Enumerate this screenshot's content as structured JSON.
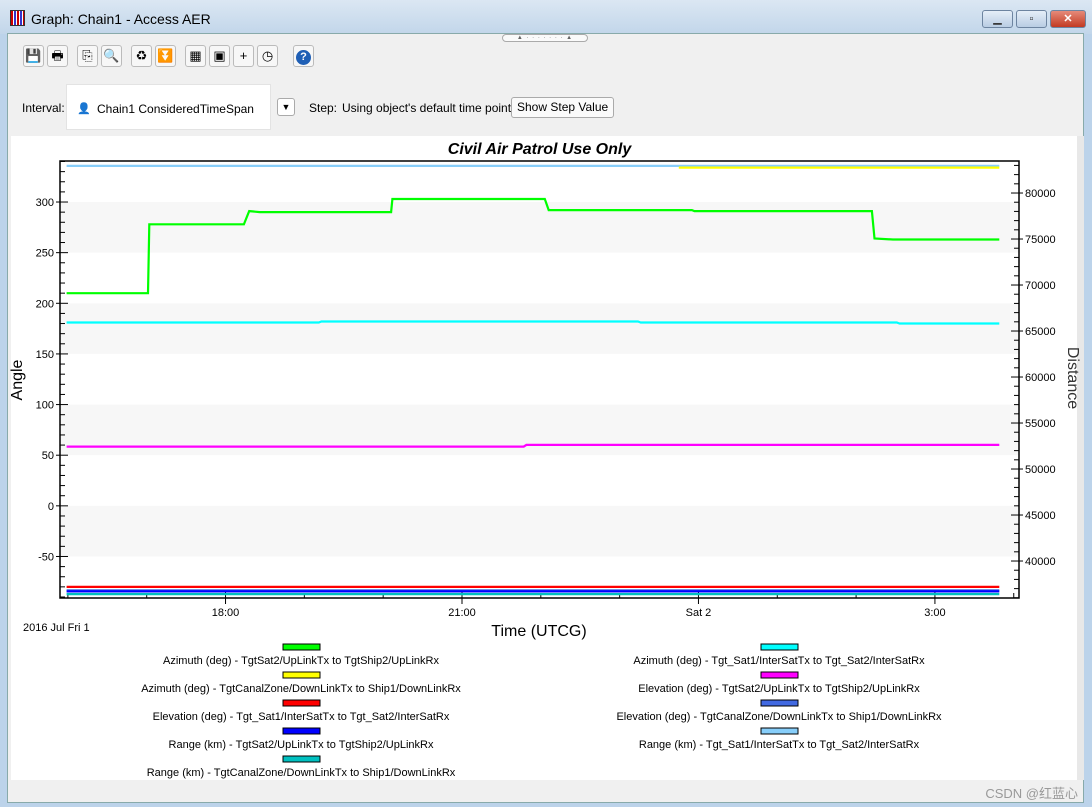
{
  "window": {
    "title": "Graph:  Chain1 - Access AER",
    "minimize": "▁",
    "maximize": "▫",
    "close": "✕"
  },
  "toolbar": [
    {
      "name": "save-icon",
      "glyph": "💾"
    },
    {
      "name": "print-icon",
      "glyph": "🖶"
    },
    {
      "name": "copy-icon",
      "glyph": "⎘"
    },
    {
      "name": "zoom-out-icon",
      "glyph": "🔍"
    },
    {
      "name": "refresh-icon",
      "glyph": "♻"
    },
    {
      "name": "export-icon",
      "glyph": "⏬"
    },
    {
      "name": "properties-icon",
      "glyph": "▦"
    },
    {
      "name": "save-as-icon",
      "glyph": "▣"
    },
    {
      "name": "crosshair-icon",
      "glyph": "+"
    },
    {
      "name": "time-icon",
      "glyph": "◷"
    },
    {
      "name": "help-icon",
      "glyph": "?"
    }
  ],
  "interval": {
    "label": "Interval:",
    "value": "Chain1 ConsideredTimeSpan",
    "dropdown": "▼"
  },
  "step": {
    "label": "Step:",
    "value": "Using object's default time points",
    "button": "Show Step Value"
  },
  "watermark": "CSDN @红蓝心",
  "chart_data": {
    "type": "line",
    "title": "Civil Air Patrol Use Only",
    "xlabel": "Time (UTCG)",
    "ylabel": "Angle",
    "y2label": "Distance",
    "date_label": "2016 Jul Fri 1",
    "xlim": [
      "2016-07-01 15:54",
      "2016-07-02 04:04"
    ],
    "ylim": [
      -91,
      340.5
    ],
    "y2lim": [
      35980,
      83480
    ],
    "xticks": [
      {
        "t": "2016-07-01 18:00",
        "label": "18:00"
      },
      {
        "t": "2016-07-01 21:00",
        "label": "21:00"
      },
      {
        "t": "2016-07-02 00:00",
        "label": "Sat 2"
      },
      {
        "t": "2016-07-02 03:00",
        "label": "3:00"
      }
    ],
    "yticks": [
      -50,
      0,
      50,
      100,
      150,
      200,
      250,
      300
    ],
    "y2ticks": [
      40000,
      45000,
      50000,
      55000,
      60000,
      65000,
      70000,
      75000,
      80000
    ],
    "grid": "alternating horizontal bands",
    "legend": "bottom",
    "series": [
      {
        "name": "Azimuth (deg) - TgtSat2/UpLinkTx to TgtShip2/UpLinkRx",
        "color": "#00ff00",
        "axis": "left",
        "points": [
          [
            "2016-07-01 15:59",
            210
          ],
          [
            "2016-07-01 17:01",
            210
          ],
          [
            "2016-07-01 17:02",
            278
          ],
          [
            "2016-07-01 18:14",
            278
          ],
          [
            "2016-07-01 18:18",
            291
          ],
          [
            "2016-07-01 18:26",
            290
          ],
          [
            "2016-07-01 20:06",
            290
          ],
          [
            "2016-07-01 20:07",
            303
          ],
          [
            "2016-07-01 22:03",
            303
          ],
          [
            "2016-07-01 22:06",
            292
          ],
          [
            "2016-07-01 23:55",
            292
          ],
          [
            "2016-07-01 23:57",
            291
          ],
          [
            "2016-07-02 02:12",
            291
          ],
          [
            "2016-07-02 02:14",
            264
          ],
          [
            "2016-07-02 02:28",
            263
          ],
          [
            "2016-07-02 03:49",
            263
          ]
        ]
      },
      {
        "name": "Azimuth (deg) - Tgt_Sat1/InterSatTx to Tgt_Sat2/InterSatRx",
        "color": "#00ffff",
        "axis": "left",
        "points": [
          [
            "2016-07-01 15:59",
            181
          ],
          [
            "2016-07-01 19:11",
            181
          ],
          [
            "2016-07-01 19:13",
            182
          ],
          [
            "2016-07-01 23:14",
            182
          ],
          [
            "2016-07-01 23:16",
            181
          ],
          [
            "2016-07-02 02:31",
            181
          ],
          [
            "2016-07-02 02:33",
            180
          ],
          [
            "2016-07-02 03:49",
            180
          ]
        ]
      },
      {
        "name": "Azimuth (deg) - TgtCanalZone/DownLinkTx to Ship1/DownLinkRx",
        "color": "#ffff00",
        "axis": "left",
        "points": [
          [
            "2016-07-01 23:45",
            334
          ],
          [
            "2016-07-02 03:49",
            334
          ]
        ]
      },
      {
        "name": "Elevation (deg) - TgtSat2/UpLinkTx to TgtShip2/UpLinkRx",
        "color": "#ff00ff",
        "axis": "left",
        "points": [
          [
            "2016-07-01 15:59",
            58.5
          ],
          [
            "2016-07-01 21:47",
            58.5
          ],
          [
            "2016-07-01 21:49",
            60.2
          ],
          [
            "2016-07-02 03:49",
            60.2
          ]
        ]
      },
      {
        "name": "Elevation (deg) - Tgt_Sat1/InterSatTx to Tgt_Sat2/InterSatRx",
        "color": "#ff0000",
        "axis": "left",
        "points": [
          [
            "2016-07-01 15:59",
            -80
          ],
          [
            "2016-07-02 03:49",
            -80
          ]
        ]
      },
      {
        "name": "Elevation (deg) - TgtCanalZone/DownLinkTx to Ship1/DownLinkRx",
        "color": "#4169e1",
        "axis": "left",
        "points": [
          [
            "2016-07-01 15:59",
            -83.5
          ],
          [
            "2016-07-02 03:49",
            -83.5
          ]
        ]
      },
      {
        "name": "Range (km) - TgtSat2/UpLinkTx to TgtShip2/UpLinkRx",
        "color": "#0000ff",
        "axis": "right",
        "points": [
          [
            "2016-07-01 15:59",
            36700
          ],
          [
            "2016-07-02 03:49",
            36700
          ]
        ]
      },
      {
        "name": "Range (km) - Tgt_Sat1/InterSatTx to Tgt_Sat2/InterSatRx",
        "color": "#87cefa",
        "axis": "right",
        "points": [
          [
            "2016-07-01 15:59",
            82950
          ],
          [
            "2016-07-02 03:49",
            82950
          ]
        ]
      },
      {
        "name": "Range (km) - TgtCanalZone/DownLinkTx to Ship1/DownLinkRx",
        "color": "#00c0c0",
        "axis": "right",
        "points": [
          [
            "2016-07-01 15:59",
            36400
          ],
          [
            "2016-07-02 03:49",
            36400
          ]
        ]
      }
    ]
  }
}
